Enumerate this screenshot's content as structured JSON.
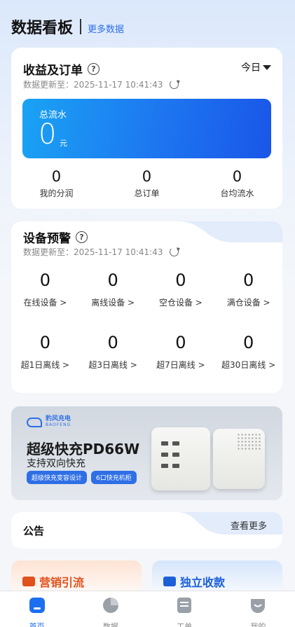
{
  "header": {
    "title": "数据看板",
    "more_link": "更多数据"
  },
  "revenue": {
    "title": "收益及订单",
    "period": "今日",
    "update_prefix": "数据更新至：",
    "update_time": "2025-11-17 10:41:43",
    "total_flow": {
      "label": "总流水",
      "value": "0",
      "unit": "元"
    },
    "stats": [
      {
        "value": "0",
        "label": "我的分润"
      },
      {
        "value": "0",
        "label": "总订单"
      },
      {
        "value": "0",
        "label": "台均流水"
      }
    ]
  },
  "devices": {
    "title": "设备预警",
    "update_prefix": "数据更新至：",
    "update_time": "2025-11-17 10:41:43",
    "row1": [
      {
        "value": "0",
        "label": "在线设备 >"
      },
      {
        "value": "0",
        "label": "离线设备 >"
      },
      {
        "value": "0",
        "label": "空仓设备 >"
      },
      {
        "value": "0",
        "label": "满仓设备 >"
      }
    ],
    "row2": [
      {
        "value": "0",
        "label": "超1日离线 >"
      },
      {
        "value": "0",
        "label": "超3日离线 >"
      },
      {
        "value": "0",
        "label": "超7日离线 >"
      },
      {
        "value": "0",
        "label": "超30日离线 >"
      }
    ]
  },
  "banner": {
    "brand_cn": "豹风充电",
    "brand_en": "BAOFENG",
    "title": "超级快充PD66W",
    "subtitle": "支持双向快充",
    "chips": [
      "超级快充变容设计",
      "6口快充机柜"
    ]
  },
  "notice": {
    "title": "公告",
    "more": "查看更多"
  },
  "promos": [
    {
      "title": "营销引流",
      "icon": "chart-icon",
      "color": "#e0521d"
    },
    {
      "title": "独立收款",
      "icon": "wallet-icon",
      "color": "#1d5fd8"
    }
  ],
  "tabbar": {
    "tabs": [
      {
        "label": "首页",
        "icon": "home-icon",
        "active": true
      },
      {
        "label": "数据",
        "icon": "pie-chart-icon",
        "active": false
      },
      {
        "label": "工单",
        "icon": "document-icon",
        "active": false
      },
      {
        "label": "我的",
        "icon": "profile-icon",
        "active": false
      }
    ],
    "accent": "#1d6ef0"
  }
}
